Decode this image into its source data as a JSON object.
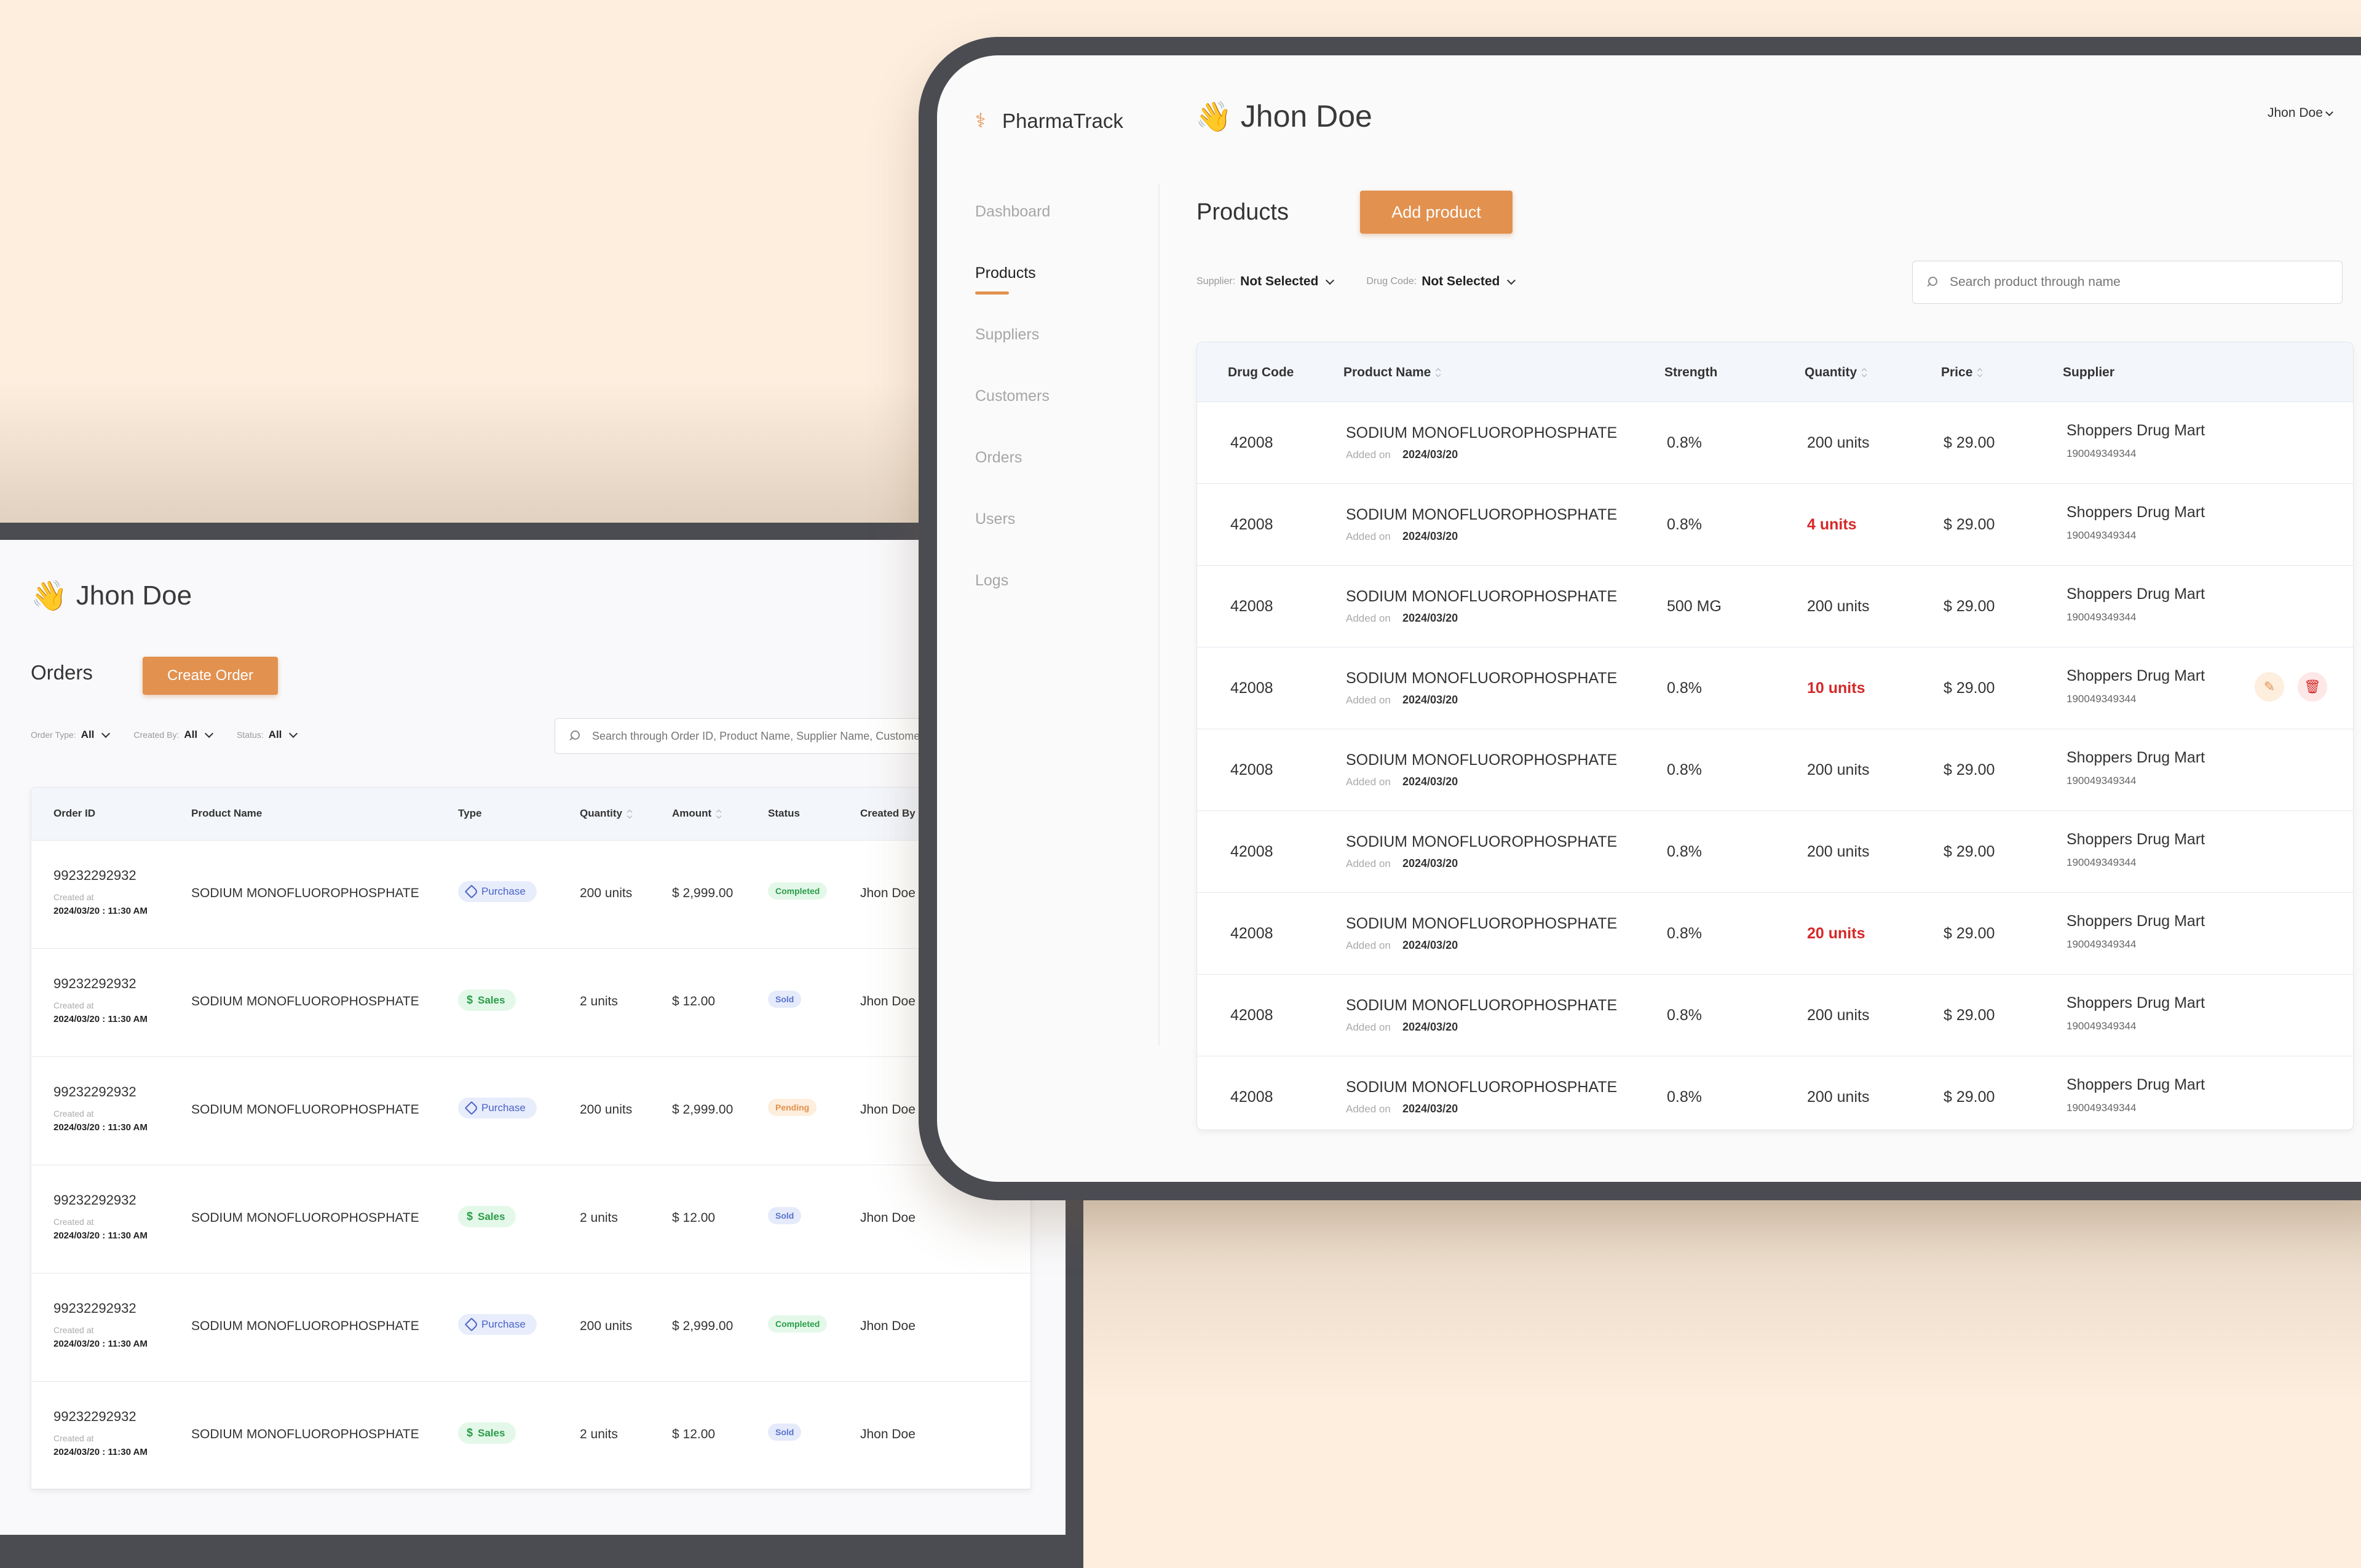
{
  "orders": {
    "user": "Jhon Doe",
    "title": "Orders",
    "create_label": "Create Order",
    "filters": [
      {
        "label": "Order Type:",
        "value": "All"
      },
      {
        "label": "Created By:",
        "value": "All"
      },
      {
        "label": "Status:",
        "value": "All"
      }
    ],
    "search_placeholder": "Search through Order ID, Product Name, Supplier Name, Customer",
    "columns": [
      "Order ID",
      "Product Name",
      "Type",
      "Quantity",
      "Amount",
      "Status",
      "Created By"
    ],
    "created_label": "Created at",
    "rows": [
      {
        "id": "99232292932",
        "created": "2024/03/20 : 11:30 AM",
        "name": "SODIUM MONOFLUOROPHOSPHATE",
        "type": "Purchase",
        "qty": "200 units",
        "amount": "$ 2,999.00",
        "status": "Completed",
        "by": "Jhon Doe"
      },
      {
        "id": "99232292932",
        "created": "2024/03/20 : 11:30 AM",
        "name": "SODIUM MONOFLUOROPHOSPHATE",
        "type": "Sales",
        "qty": "2 units",
        "amount": "$ 12.00",
        "status": "Sold",
        "by": "Jhon Doe"
      },
      {
        "id": "99232292932",
        "created": "2024/03/20 : 11:30 AM",
        "name": "SODIUM MONOFLUOROPHOSPHATE",
        "type": "Purchase",
        "qty": "200 units",
        "amount": "$ 2,999.00",
        "status": "Pending",
        "by": "Jhon Doe"
      },
      {
        "id": "99232292932",
        "created": "2024/03/20 : 11:30 AM",
        "name": "SODIUM MONOFLUOROPHOSPHATE",
        "type": "Sales",
        "qty": "2 units",
        "amount": "$ 12.00",
        "status": "Sold",
        "by": "Jhon Doe"
      },
      {
        "id": "99232292932",
        "created": "2024/03/20 : 11:30 AM",
        "name": "SODIUM MONOFLUOROPHOSPHATE",
        "type": "Purchase",
        "qty": "200 units",
        "amount": "$ 2,999.00",
        "status": "Completed",
        "by": "Jhon Doe"
      },
      {
        "id": "99232292932",
        "created": "2024/03/20 : 11:30 AM",
        "name": "SODIUM MONOFLUOROPHOSPHATE",
        "type": "Sales",
        "qty": "2 units",
        "amount": "$ 12.00",
        "status": "Sold",
        "by": "Jhon Doe"
      }
    ]
  },
  "products": {
    "app_name": "PharmaTrack",
    "user": "Jhon Doe",
    "user_menu": "Jhon Doe",
    "nav": [
      "Dashboard",
      "Products",
      "Suppliers",
      "Customers",
      "Orders",
      "Users",
      "Logs"
    ],
    "active_nav": "Products",
    "title": "Products",
    "add_label": "Add product",
    "filters": [
      {
        "label": "Supplier:",
        "value": "Not Selected"
      },
      {
        "label": "Drug Code:",
        "value": "Not Selected"
      }
    ],
    "search_placeholder": "Search product through name",
    "columns": [
      "Drug Code",
      "Product Name",
      "Strength",
      "Quantity",
      "Price",
      "Supplier"
    ],
    "added_label": "Added on",
    "rows": [
      {
        "code": "42008",
        "name": "SODIUM MONOFLUOROPHOSPHATE",
        "added": "2024/03/20",
        "strength": "0.8%",
        "qty": "200 units",
        "low": false,
        "price": "$ 29.00",
        "supplier": "Shoppers Drug Mart",
        "supplier_id": "190049349344"
      },
      {
        "code": "42008",
        "name": "SODIUM MONOFLUOROPHOSPHATE",
        "added": "2024/03/20",
        "strength": "0.8%",
        "qty": "4 units",
        "low": true,
        "price": "$ 29.00",
        "supplier": "Shoppers Drug Mart",
        "supplier_id": "190049349344"
      },
      {
        "code": "42008",
        "name": "SODIUM MONOFLUOROPHOSPHATE",
        "added": "2024/03/20",
        "strength": "500 MG",
        "qty": "200 units",
        "low": false,
        "price": "$ 29.00",
        "supplier": "Shoppers Drug Mart",
        "supplier_id": "190049349344"
      },
      {
        "code": "42008",
        "name": "SODIUM MONOFLUOROPHOSPHATE",
        "added": "2024/03/20",
        "strength": "0.8%",
        "qty": "10 units",
        "low": true,
        "price": "$ 29.00",
        "supplier": "Shoppers Drug Mart",
        "supplier_id": "190049349344",
        "actions": true
      },
      {
        "code": "42008",
        "name": "SODIUM MONOFLUOROPHOSPHATE",
        "added": "2024/03/20",
        "strength": "0.8%",
        "qty": "200 units",
        "low": false,
        "price": "$ 29.00",
        "supplier": "Shoppers Drug Mart",
        "supplier_id": "190049349344"
      },
      {
        "code": "42008",
        "name": "SODIUM MONOFLUOROPHOSPHATE",
        "added": "2024/03/20",
        "strength": "0.8%",
        "qty": "200 units",
        "low": false,
        "price": "$ 29.00",
        "supplier": "Shoppers Drug Mart",
        "supplier_id": "190049349344"
      },
      {
        "code": "42008",
        "name": "SODIUM MONOFLUOROPHOSPHATE",
        "added": "2024/03/20",
        "strength": "0.8%",
        "qty": "20 units",
        "low": true,
        "price": "$ 29.00",
        "supplier": "Shoppers Drug Mart",
        "supplier_id": "190049349344"
      },
      {
        "code": "42008",
        "name": "SODIUM MONOFLUOROPHOSPHATE",
        "added": "2024/03/20",
        "strength": "0.8%",
        "qty": "200 units",
        "low": false,
        "price": "$ 29.00",
        "supplier": "Shoppers Drug Mart",
        "supplier_id": "190049349344"
      },
      {
        "code": "42008",
        "name": "SODIUM MONOFLUOROPHOSPHATE",
        "added": "2024/03/20",
        "strength": "0.8%",
        "qty": "200 units",
        "low": false,
        "price": "$ 29.00",
        "supplier": "Shoppers Drug Mart",
        "supplier_id": "190049349344"
      }
    ]
  },
  "icons": {
    "wave": "waving-hand-icon",
    "logo": "pharmacy-logo-icon",
    "edit": "pencil-icon",
    "delete": "trash-icon",
    "search": "search-icon"
  },
  "colors": {
    "accent": "#E2914F",
    "danger": "#D62828",
    "success": "#2A9D49",
    "info": "#4A62C8",
    "background": "#FDEEDE"
  }
}
